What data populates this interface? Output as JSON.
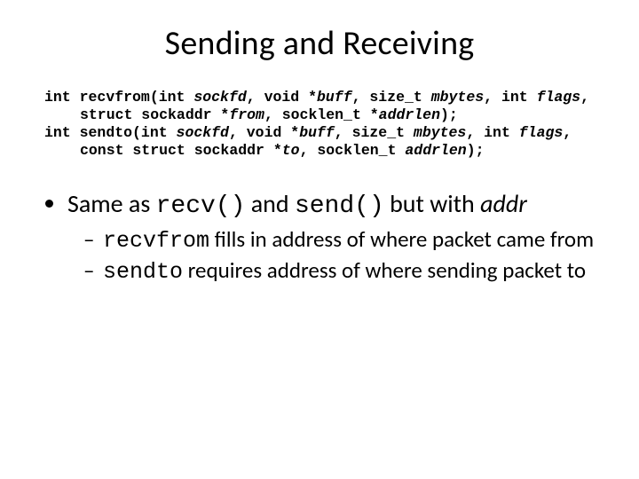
{
  "title": "Sending and Receiving",
  "decl1": {
    "ret": "int ",
    "name": "recvfrom",
    "p1a": "(int ",
    "p1b": "sockfd",
    "p2a": ", void *",
    "p2b": "buff",
    "p3a": ", size_t ",
    "p3b": "mbytes",
    "p4a": ", int ",
    "p4b": "flags",
    "p5a": ", struct sockaddr *",
    "p5b": "from",
    "p6a": ", socklen_t *",
    "p6b": "addrlen",
    "end": ");"
  },
  "decl2": {
    "ret": "int ",
    "name": "sendto",
    "p1a": "(int ",
    "p1b": "sockfd",
    "p2a": ", void *",
    "p2b": "buff",
    "p3a": ", size_t ",
    "p3b": "mbytes",
    "p4a": ", int ",
    "p4b": "flags",
    "p5a": ", const struct sockaddr *",
    "p5b": "to",
    "p6a": ", socklen_t ",
    "p6b": "addrlen",
    "end": ");"
  },
  "bullet": {
    "pre": "Same as ",
    "fn1": "recv()",
    "mid": " and ",
    "fn2": "send()",
    "post1": " but with ",
    "addr": "addr"
  },
  "sub1": {
    "fn": "recvfrom",
    "rest": " fills in address of where packet came from"
  },
  "sub2": {
    "fn": "sendto",
    "rest": " requires address of where sending packet to"
  }
}
